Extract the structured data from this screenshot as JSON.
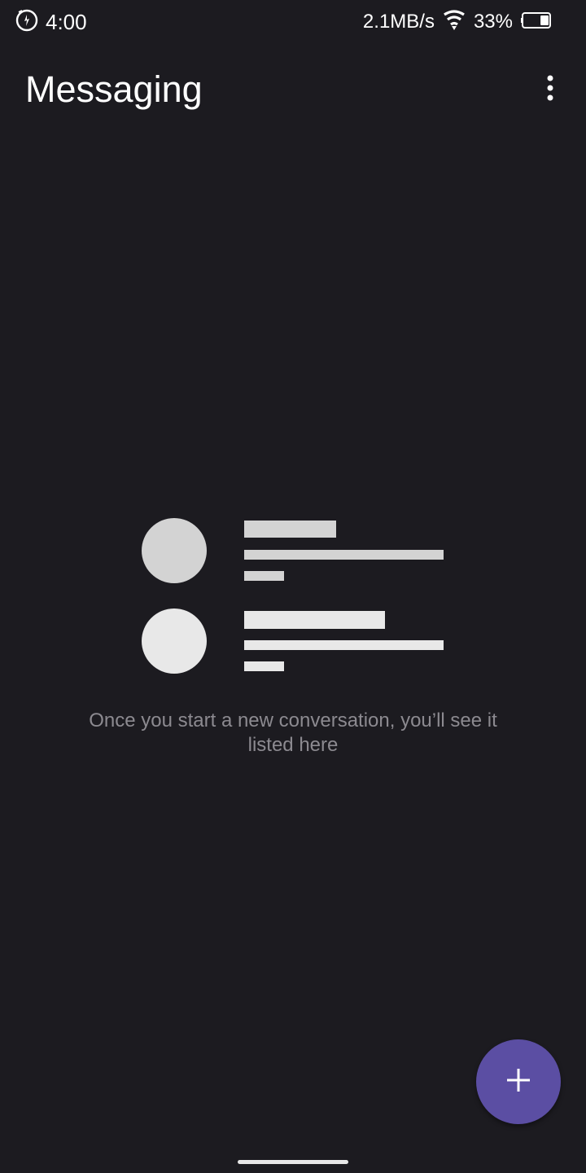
{
  "status_bar": {
    "time": "4:00",
    "network_speed": "2.1MB/s",
    "battery_percent": "33%",
    "battery_level": 0.33,
    "icons": [
      "alarm-icon",
      "wifi-icon",
      "battery-icon"
    ]
  },
  "app_bar": {
    "title": "Messaging",
    "overflow_icon": "more-vert-icon"
  },
  "empty_state": {
    "message": "Once you start a new conversation, you’ll see it listed here"
  },
  "fab": {
    "icon": "plus-icon",
    "color": "#5b4ea3"
  },
  "colors": {
    "background": "#1c1b20",
    "placeholder_dark": "#d3d3d3",
    "placeholder_light": "#e8e8e8",
    "secondary_text": "#8c8a90"
  }
}
